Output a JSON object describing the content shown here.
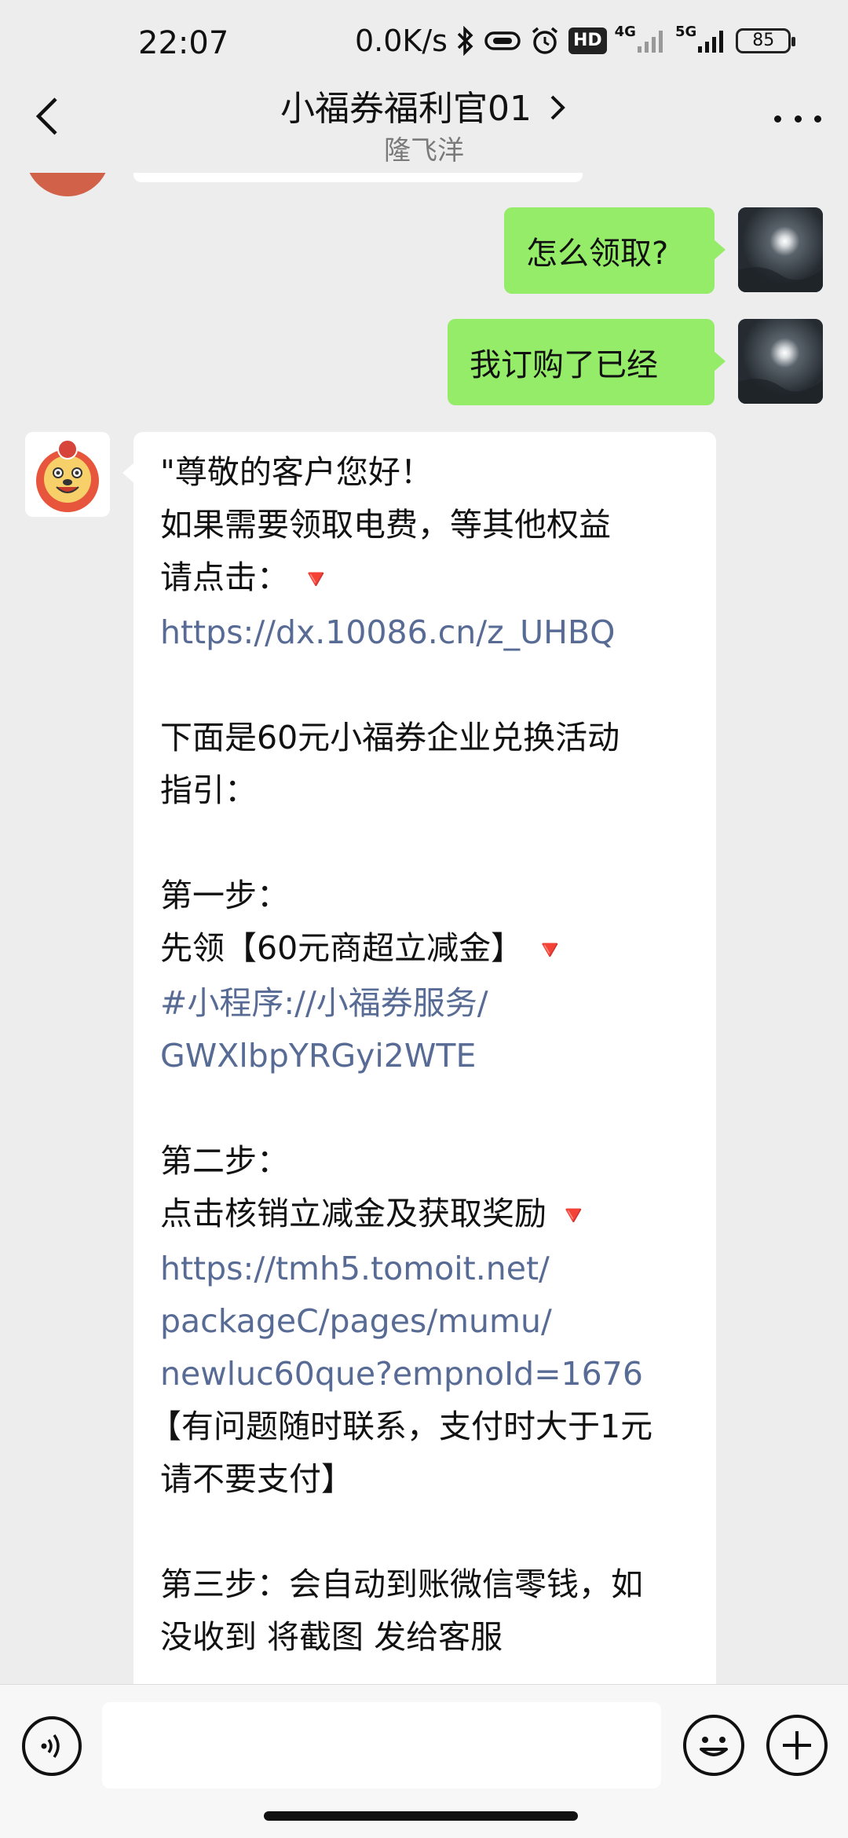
{
  "status_bar": {
    "time": "22:07",
    "net_speed": "0.0K/s",
    "hd_label": "HD",
    "sim1_label": "4G",
    "sim2_label": "5G",
    "battery": "85"
  },
  "header": {
    "title": "小福券福利官01",
    "subtitle": "隆飞洋"
  },
  "messages": {
    "sent": [
      {
        "text": "怎么领取?"
      },
      {
        "text": "我订购了已经"
      }
    ],
    "received": {
      "lines": [
        "\"尊敬的客户您好！",
        "如果需要领取电费，等其他权益",
        "请点击：",
        "https://dx.10086.cn/z_UHBQ",
        "下面是60元小福券企业兑换活动",
        "指引：",
        "第一步：",
        "先领【60元商超立减金】",
        "#小程序://小福券服务/",
        "GWXlbpYRGyi2WTE",
        "第二步：",
        "点击核销立减金及获取奖励",
        "https://tmh5.tomoit.net/",
        "packageC/pages/mumu/",
        "newluc60que?empnoId=1676",
        "【有问题随时联系，支付时大于1元",
        "请不要支付】",
        "第三步：会自动到账微信零钱，如",
        "没收到 将截图  发给客服"
      ],
      "arrow": "🔻"
    }
  },
  "colors": {
    "background": "#ededed",
    "sent_bubble": "#95ec69",
    "link": "#576b95",
    "arrow": "#e2402e"
  },
  "icons": [
    "back-icon",
    "chevron-right-icon",
    "more-icon",
    "voice-icon",
    "emoji-icon",
    "plus-icon",
    "bluetooth-icon",
    "alarm-icon"
  ]
}
